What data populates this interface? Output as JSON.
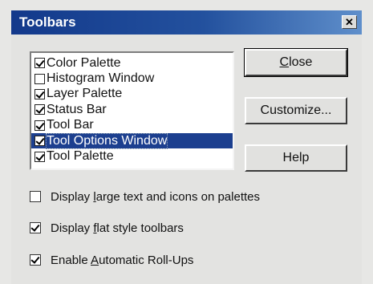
{
  "dialog": {
    "title": "Toolbars",
    "close_glyph": "✕"
  },
  "list": {
    "items": [
      {
        "label": "Color Palette",
        "checked": true,
        "selected": false
      },
      {
        "label": "Histogram Window",
        "checked": false,
        "selected": false
      },
      {
        "label": "Layer Palette",
        "checked": true,
        "selected": false
      },
      {
        "label": "Status Bar",
        "checked": true,
        "selected": false
      },
      {
        "label": "Tool Bar",
        "checked": true,
        "selected": false
      },
      {
        "label": "Tool Options Window",
        "checked": true,
        "selected": true
      },
      {
        "label": "Tool Palette",
        "checked": true,
        "selected": false
      }
    ]
  },
  "buttons": {
    "close": {
      "pre": "",
      "key": "C",
      "post": "lose"
    },
    "customize": "Customize...",
    "help": "Help"
  },
  "options": [
    {
      "pre": "Display ",
      "key": "l",
      "post": "arge text and icons on palettes",
      "checked": false
    },
    {
      "pre": "Display ",
      "key": "f",
      "post": "lat style toolbars",
      "checked": true
    },
    {
      "pre": "Enable ",
      "key": "A",
      "post": "utomatic Roll-Ups",
      "checked": true
    }
  ],
  "colors": {
    "title_bar_start": "#13398b",
    "title_bar_end": "#5f8fcb",
    "selection": "#1c3f8f",
    "dialog_face": "#e3e3e1"
  }
}
